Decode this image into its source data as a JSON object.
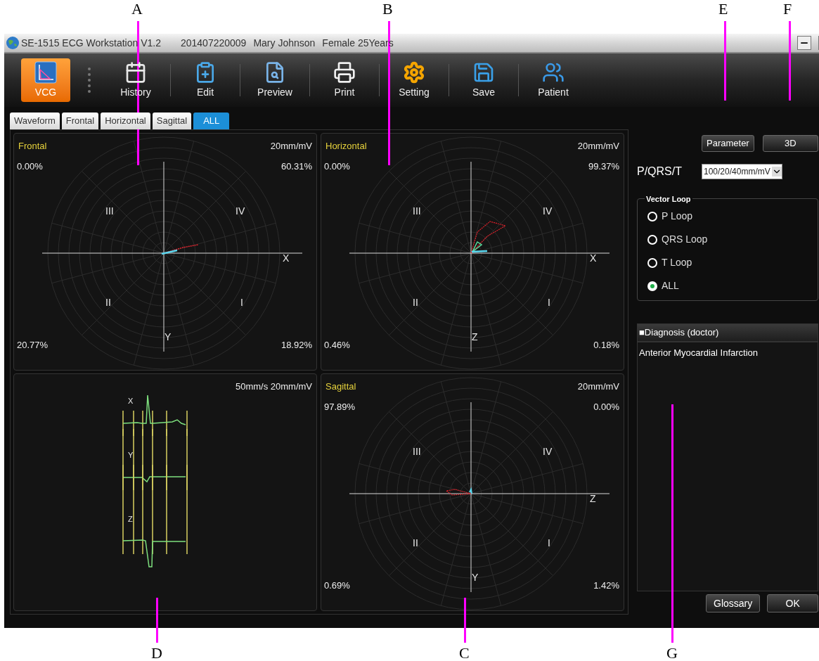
{
  "callouts_top": [
    "A",
    "B",
    "E",
    "F"
  ],
  "callouts_bottom": [
    "D",
    "C",
    "G"
  ],
  "window": {
    "title": "SE-1515 ECG Workstation V1.2",
    "record_id": "201407220009",
    "patient": "Mary Johnson",
    "sex_age": "Female 25Years"
  },
  "toolbar": [
    {
      "label": "VCG",
      "selected": true
    },
    {
      "label": "History",
      "selected": false
    },
    {
      "label": "Edit",
      "selected": false
    },
    {
      "label": "Preview",
      "selected": false
    },
    {
      "label": "Print",
      "selected": false
    },
    {
      "label": "Setting",
      "selected": false
    },
    {
      "label": "Save",
      "selected": false
    },
    {
      "label": "Patient",
      "selected": false
    }
  ],
  "tabs": [
    {
      "label": "Waveform",
      "selected": false
    },
    {
      "label": "Frontal",
      "selected": false
    },
    {
      "label": "Horizontal",
      "selected": false
    },
    {
      "label": "Sagittal",
      "selected": false
    },
    {
      "label": "ALL",
      "selected": true
    }
  ],
  "plots": [
    {
      "kind": "polar",
      "title": "Frontal",
      "scale": "20mm/mV",
      "corners": [
        "0.00%",
        "60.31%",
        "20.77%",
        "18.92%"
      ],
      "quadrants": [
        "III",
        "IV",
        "II",
        "I"
      ],
      "axes": [
        "X",
        "Y"
      ]
    },
    {
      "kind": "polar",
      "title": "Horizontal",
      "scale": "20mm/mV",
      "corners": [
        "0.00%",
        "99.37%",
        "0.46%",
        "0.18%"
      ],
      "quadrants": [
        "III",
        "IV",
        "II",
        "I"
      ],
      "axes": [
        "X",
        "Z"
      ]
    },
    {
      "kind": "waveform",
      "scale": "50mm/s 20mm/mV",
      "leads": [
        "X",
        "Y",
        "Z"
      ]
    },
    {
      "kind": "polar",
      "title": "Sagittal",
      "scale": "20mm/mV",
      "corners": [
        "97.89%",
        "0.00%",
        "0.69%",
        "1.42%"
      ],
      "quadrants": [
        "III",
        "IV",
        "II",
        "I"
      ],
      "axes": [
        "Z",
        "Y"
      ]
    }
  ],
  "side_panel": {
    "buttons": [
      "Parameter",
      "3D"
    ],
    "pqrst_label": "P/QRS/T",
    "pqrst_value": "100/20/40mm/mV",
    "vector_loop": {
      "title": "Vector Loop",
      "options": [
        {
          "label": "P Loop",
          "selected": false
        },
        {
          "label": "QRS Loop",
          "selected": false
        },
        {
          "label": "T Loop",
          "selected": false
        },
        {
          "label": "ALL",
          "selected": true
        }
      ]
    },
    "diagnosis": {
      "title": "■Diagnosis (doctor)",
      "text": "Anterior Myocardial Infarction"
    },
    "footer_buttons": [
      "Glossary",
      "OK"
    ]
  }
}
